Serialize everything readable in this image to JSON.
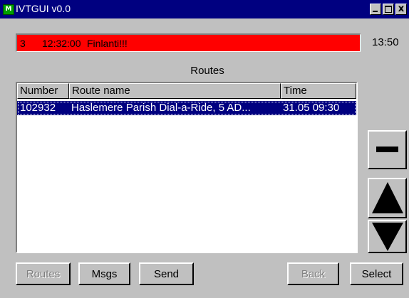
{
  "window": {
    "title": "IVTGUI v0.0",
    "app_icon_letter": "M",
    "close_glyph": "x"
  },
  "alert": {
    "number": "3",
    "time": "12:32:00",
    "message": "Finlanti!!!",
    "color": "#ff0000"
  },
  "clock": "13:50",
  "routes": {
    "heading": "Routes",
    "columns": [
      "Number",
      "Route name",
      "Time"
    ],
    "rows": [
      {
        "number": "102932",
        "name": "Haslemere Parish Dial-a-Ride, 5 AD...",
        "time": "31.05  09:30",
        "selected": true
      }
    ]
  },
  "side_buttons": {
    "minus": "minus-icon",
    "up": "arrow-up-icon",
    "down": "arrow-down-icon"
  },
  "buttons": {
    "routes": {
      "label": "Routes",
      "enabled": false
    },
    "msgs": {
      "label": "Msgs",
      "enabled": true
    },
    "send": {
      "label": "Send",
      "enabled": true
    },
    "back": {
      "label": "Back",
      "enabled": false
    },
    "select": {
      "label": "Select",
      "enabled": true
    }
  },
  "colors": {
    "titlebar": "#000080",
    "selection": "#000080",
    "face": "#c0c0c0"
  }
}
